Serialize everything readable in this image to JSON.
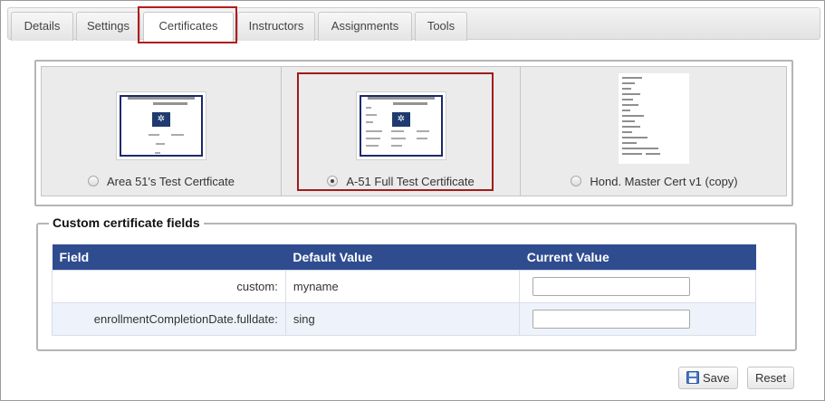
{
  "tabs": [
    {
      "label": "Details"
    },
    {
      "label": "Settings"
    },
    {
      "label": "Certificates"
    },
    {
      "label": "Instructors"
    },
    {
      "label": "Assignments"
    },
    {
      "label": "Tools"
    }
  ],
  "active_tab": "Certificates",
  "certificates": [
    {
      "label": "Area 51's Test Certficate",
      "selected": false
    },
    {
      "label": "A-51 Full Test Certificate",
      "selected": true
    },
    {
      "label": "Hond. Master Cert v1 (copy)",
      "selected": false
    }
  ],
  "custom_fields": {
    "legend": "Custom certificate fields",
    "columns": [
      "Field",
      "Default Value",
      "Current Value"
    ],
    "rows": [
      {
        "field": "custom:",
        "default": "myname",
        "current": ""
      },
      {
        "field": "enrollmentCompletionDate.fulldate:",
        "default": "sing",
        "current": ""
      }
    ]
  },
  "buttons": {
    "save_label": "Save",
    "reset_label": "Reset"
  },
  "colors": {
    "table_header": "#2f4c8f",
    "highlight": "#b01c1c"
  }
}
